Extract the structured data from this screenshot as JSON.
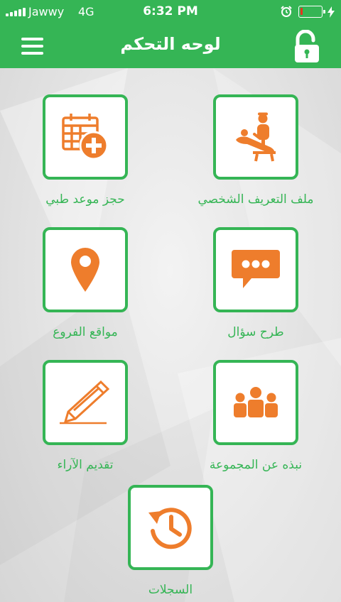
{
  "status_bar": {
    "carrier": "Jawwy",
    "network": "4G",
    "time": "6:32 PM",
    "battery_level": 0.12,
    "battery_color": "#e8331e"
  },
  "nav": {
    "title": "لوحه التحكم",
    "menu_icon": "hamburger-menu-icon",
    "lock_icon": "unlocked-padlock-icon"
  },
  "colors": {
    "brand_green": "#35b555",
    "icon_orange": "#ee7d2c"
  },
  "tiles": [
    {
      "label": "ملف التعريف الشخصي",
      "icon": "patient-doctor-icon"
    },
    {
      "label": "حجز موعد طبي",
      "icon": "calendar-add-icon"
    },
    {
      "label": "طرح سؤال",
      "icon": "chat-bubble-icon"
    },
    {
      "label": "مواقع الفروع",
      "icon": "map-pin-icon"
    },
    {
      "label": "نبذه عن المجموعة",
      "icon": "group-people-icon"
    },
    {
      "label": "تقديم الآراء",
      "icon": "pencil-icon"
    },
    {
      "label": "السجلات",
      "icon": "history-clock-icon"
    }
  ]
}
